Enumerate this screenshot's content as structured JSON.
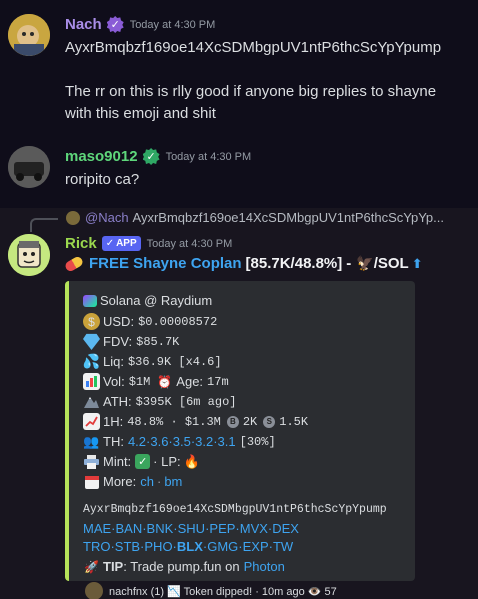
{
  "messages": [
    {
      "author": "Nach",
      "author_color": "#a98ee8",
      "timestamp": "Today at 4:30 PM",
      "lines": [
        "AyxrBmqbzf169oe14XcSDMbgpUV1ntP6thcScYpYpump",
        "",
        "The rr on this is rlly good if anyone big replies to shayne",
        "with this emoji and shit"
      ]
    },
    {
      "author": "maso9012",
      "author_color": "#5ed67b",
      "timestamp": "Today at 4:30 PM",
      "lines": [
        "roripito ca?"
      ]
    }
  ],
  "bot": {
    "reply": {
      "who": "@Nach",
      "text": "AyxrBmqbzf169oe14XcSDMbgpUV1ntP6thcScYpYp..."
    },
    "author": "Rick",
    "author_color": "#9bd84e",
    "app_label": "APP",
    "timestamp": "Today at 4:30 PM",
    "title": {
      "pill_icon": "pill-emoji",
      "link_text": "FREE Shayne Coplan",
      "stats": "[85.7K/48.8%]",
      "dash": "-",
      "pair": "/SOL",
      "arrow": "⬆"
    },
    "embed": {
      "accent": "#b6e35a",
      "network": "Solana @ Raydium",
      "usd_label": "USD:",
      "usd_value": "$0.00008572",
      "fdv_label": "FDV:",
      "fdv_value": "$85.7K",
      "liq_label": "Liq:",
      "liq_value": "$36.9K [x4.6]",
      "vol_label": "Vol:",
      "vol_value": "$1M",
      "age_label": "Age:",
      "age_value": "17m",
      "ath_label": "ATH:",
      "ath_value": "$395K [6m ago]",
      "h1_label": "1H:",
      "h1_value": "48.8% · $1.3M",
      "h1_b": "2K",
      "h1_s": "1.5K",
      "th_label": "TH:",
      "th_values": "4.2·3.6·3.5·3.2·3.1",
      "th_pct": "[30%]",
      "mint_label": "Mint:",
      "lp_label": "· LP:",
      "more_label": "More:",
      "more_ch": "ch",
      "more_sep": "·",
      "more_bm": "bm",
      "ca": "AyxrBmqbzf169oe14XcSDMbgpUV1ntP6thcScYpYpump",
      "links1": "MAE·BAN·BNK·SHU·PEP·MVX·DEX",
      "links2a": "TRO·STB·PHO·",
      "links2b": "BLX",
      "links2c": "·GMG·EXP·TW",
      "tip_label": "TIP",
      "tip_text": ": Trade pump.fun on",
      "tip_link": "Photon"
    },
    "footer": "nachfnx (1) 📉 Token dipped! · 10m ago 👁️ 57"
  }
}
